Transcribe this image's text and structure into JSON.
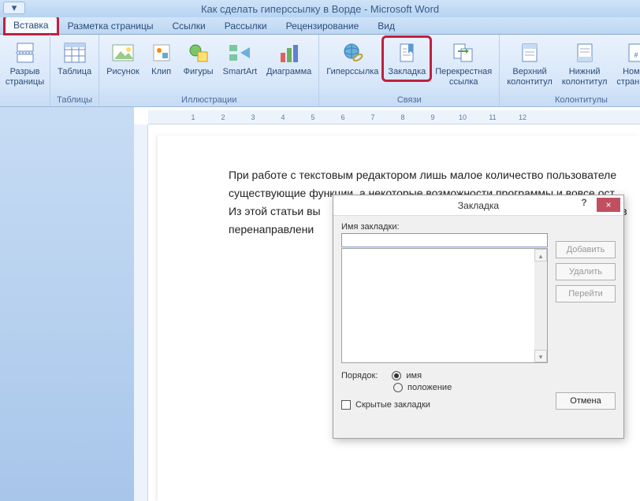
{
  "title": "Как сделать гиперссылку в Ворде - Microsoft Word",
  "tabs": [
    "Вставка",
    "Разметка страницы",
    "Ссылки",
    "Рассылки",
    "Рецензирование",
    "Вид"
  ],
  "ribbon": {
    "pages_break": "Разрыв\nстраницы",
    "table": "Таблица",
    "picture": "Рисунок",
    "clip": "Клип",
    "shapes": "Фигуры",
    "smartart": "SmartArt",
    "chart": "Диаграмма",
    "hyperlink": "Гиперссылка",
    "bookmark": "Закладка",
    "crossref": "Перекрестная\nссылка",
    "header": "Верхний\nколонтитул",
    "footer": "Нижний\nколонтитул",
    "pagenum": "Номер\nстраницы",
    "group_tables": "Таблицы",
    "group_illustrations": "Иллюстрации",
    "group_links": "Связи",
    "group_headers": "Колонтитулы"
  },
  "ruler": [
    "",
    "1",
    "2",
    "3",
    "4",
    "5",
    "6",
    "7",
    "8",
    "9",
    "10",
    "11",
    "12"
  ],
  "document": {
    "l1": "При работе с текстовым редактором лишь малое количество пользователе",
    "l2": "существующие функции, а некоторые возможности программы и вовсе ост",
    "l3": "Из этой статьи вы",
    "l3b": "ё в",
    "l4": "перенаправлени"
  },
  "dialog": {
    "title": "Закладка",
    "name_label": "Имя закладки:",
    "add": "Добавить",
    "delete": "Удалить",
    "goto": "Перейти",
    "order_label": "Порядок:",
    "order_name": "имя",
    "order_pos": "положение",
    "hidden": "Скрытые закладки",
    "cancel": "Отмена"
  }
}
